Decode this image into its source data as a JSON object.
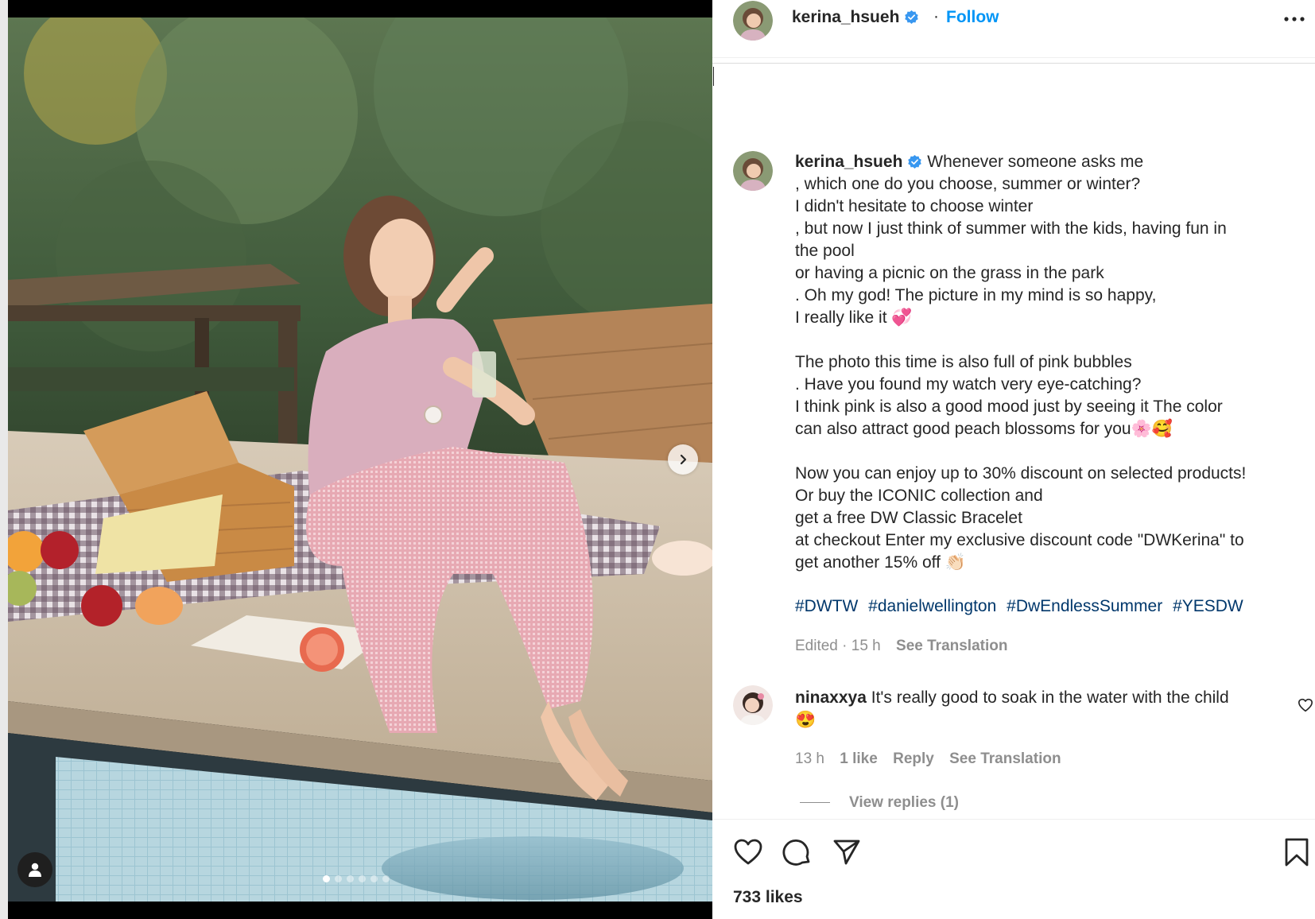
{
  "post": {
    "author": "kerina_hsueh",
    "follow_label": "Follow",
    "separator": "·",
    "media": {
      "slide_count": 6,
      "active_slide": 1
    }
  },
  "caption": {
    "username": "kerina_hsueh",
    "lines": [
      "Whenever someone asks me",
      ", which one do you choose, summer or winter?",
      "I didn't hesitate to choose winter",
      ", but now I just think of summer with the kids, having fun in",
      "the pool",
      "or having a picnic on the grass in the park",
      ". Oh my god! The picture in my mind is so happy,",
      "I really like it 💞",
      "",
      "The photo this time is also full of pink bubbles",
      ". Have you found my watch very eye-catching?",
      "I think pink is also a good mood just by seeing it The color",
      "can also attract good peach blossoms for you🌸🥰",
      "",
      "Now you can enjoy up to 30% discount on selected products!",
      "Or buy the ICONIC collection and",
      "get a free DW Classic Bracelet",
      "at checkout Enter my exclusive discount code \"DWKerina\" to",
      "get another 15% off 👏🏻"
    ],
    "hashtags": [
      "#DWTW",
      "#danielwellington",
      "#DwEndlessSummer",
      "#YESDW"
    ],
    "meta_time": "Edited · 15 h",
    "see_translation": "See Translation"
  },
  "comment": {
    "username": "ninaxxya",
    "text": "It's really good to soak in the water with the child",
    "emoji": "😍",
    "time": "13 h",
    "likes": "1 like",
    "reply": "Reply",
    "see_translation": "See Translation",
    "view_replies": "View replies (1)"
  },
  "likes_count": "733 likes",
  "icons": {
    "verified": "verified-badge-icon",
    "more": "more-options-icon",
    "like": "heart-icon",
    "comment": "comment-icon",
    "share": "share-icon",
    "save": "bookmark-icon",
    "next": "chevron-right-icon",
    "tag": "user-tag-icon"
  },
  "colors": {
    "follow": "#0095f6",
    "hashtag": "#00376b",
    "secondary_text": "#8e8e8e",
    "verified": "#3897f0"
  }
}
